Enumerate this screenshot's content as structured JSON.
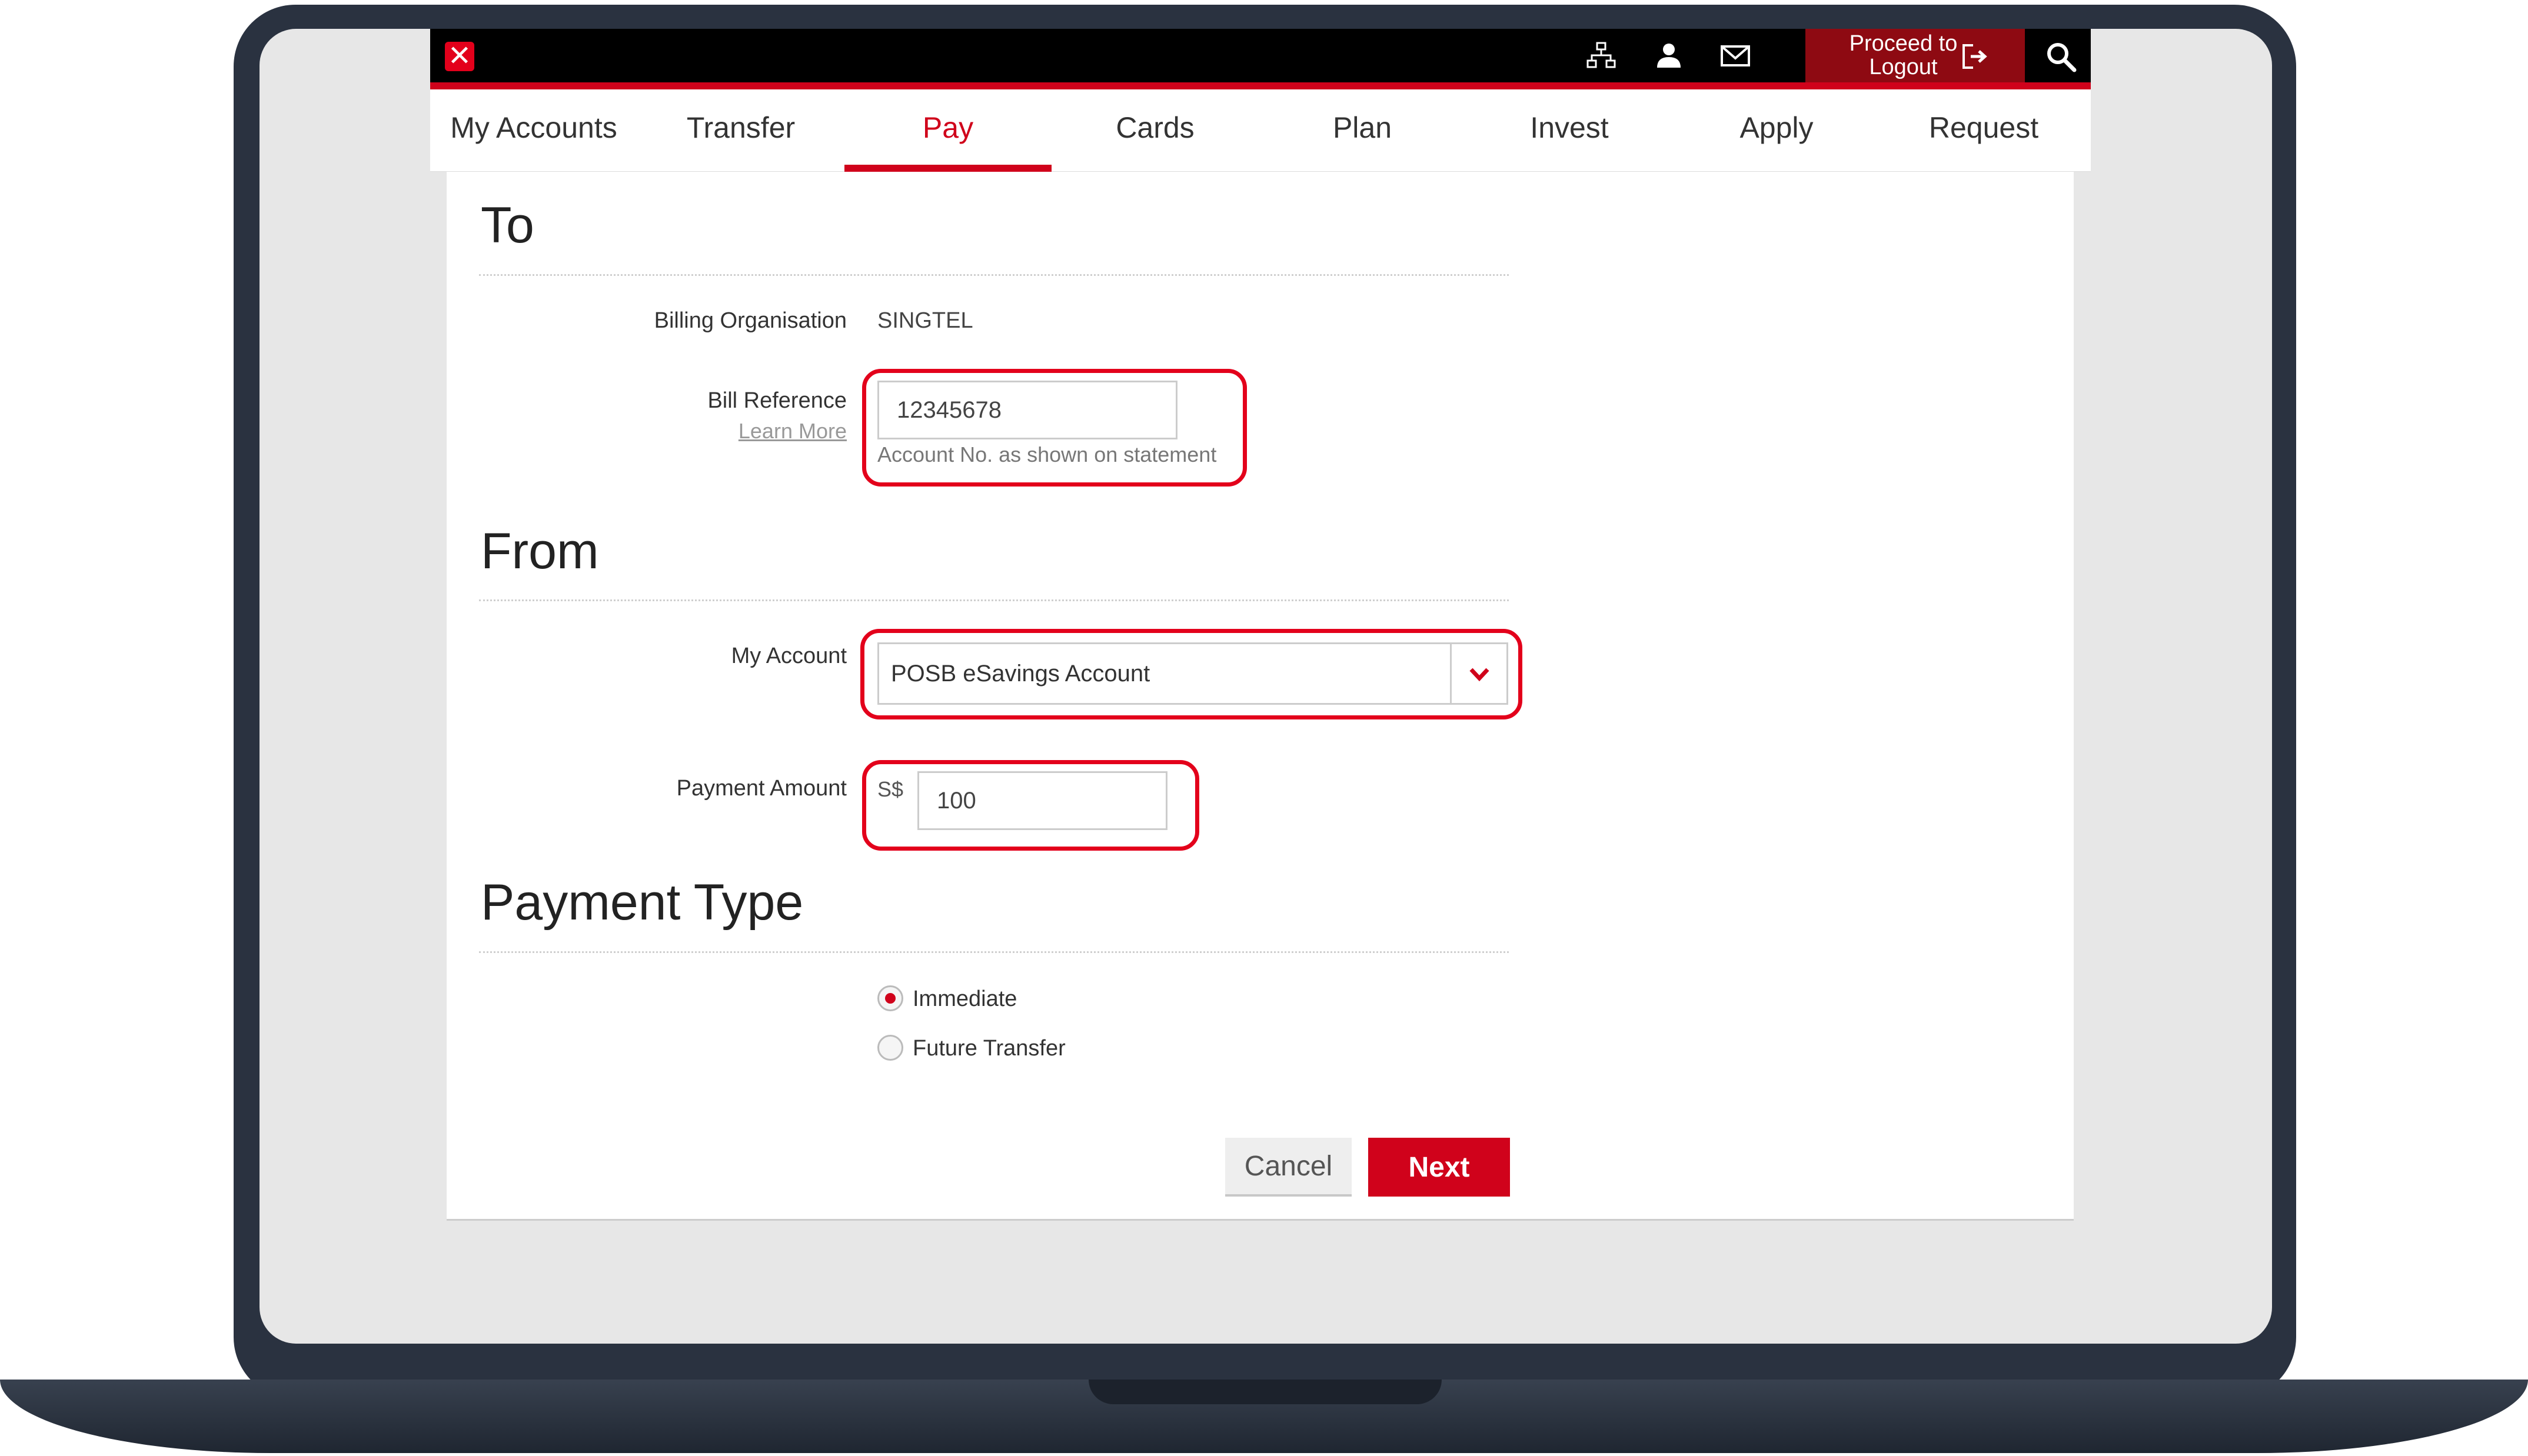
{
  "topbar": {
    "logo_glyph": "✕",
    "icons": {
      "sitemap": "sitemap-icon",
      "profile": "user-icon",
      "mail": "mail-icon",
      "search": "search-icon"
    },
    "logout_line1": "Proceed to",
    "logout_line2": "Logout"
  },
  "nav": {
    "items": [
      "My Accounts",
      "Transfer",
      "Pay",
      "Cards",
      "Plan",
      "Invest",
      "Apply",
      "Request"
    ],
    "active": "Pay"
  },
  "form": {
    "to": {
      "title": "To",
      "billing_org_label": "Billing Organisation",
      "billing_org_value": "SINGTEL",
      "bill_ref_label": "Bill Reference",
      "learn_more": "Learn More",
      "bill_ref_value": "12345678",
      "bill_ref_hint": "Account No. as shown on statement"
    },
    "from": {
      "title": "From",
      "my_account_label": "My Account",
      "my_account_value": "POSB eSavings Account",
      "payment_amount_label": "Payment Amount",
      "currency": "S$",
      "payment_amount_value": "100"
    },
    "payment_type": {
      "title": "Payment Type",
      "options": [
        "Immediate",
        "Future Transfer"
      ],
      "selected": "Immediate"
    },
    "buttons": {
      "cancel": "Cancel",
      "next": "Next"
    }
  },
  "colors": {
    "brand_red": "#d0021b",
    "highlight_red": "#e3001b",
    "logout_bg": "#8e0a12",
    "laptop_frame": "#2a3240"
  }
}
